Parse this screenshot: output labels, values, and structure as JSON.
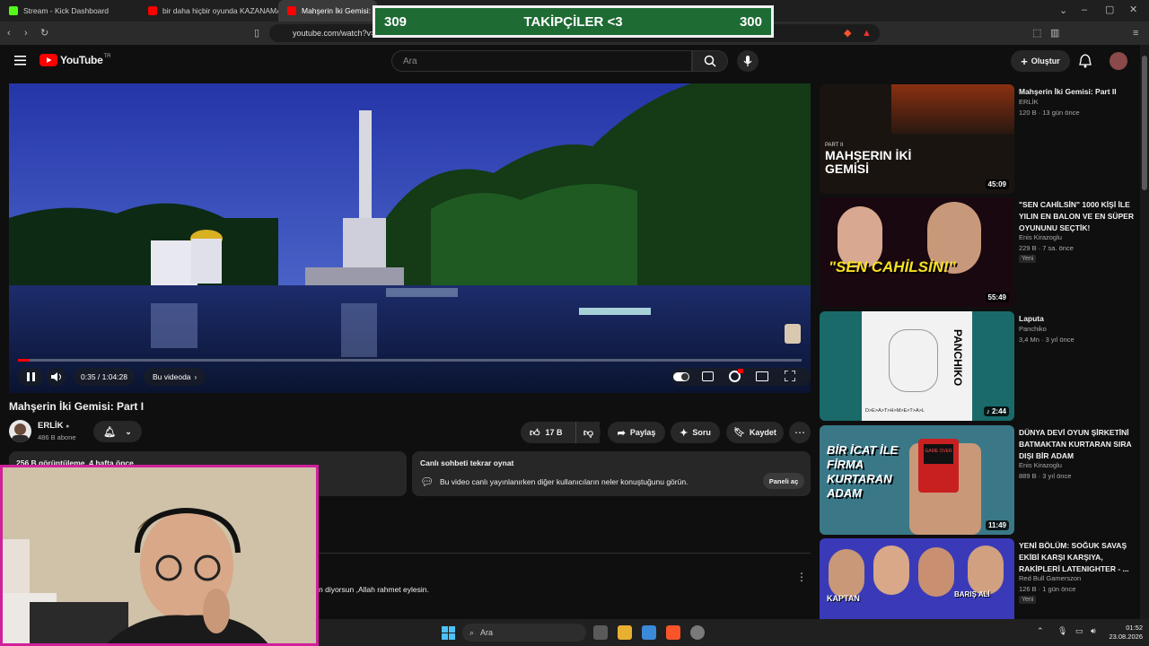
{
  "browser": {
    "tabs": [
      {
        "title": "Stream - Kick Dashboard",
        "fav_color": "#53fc18"
      },
      {
        "title": "bir daha hiçbir oyunda KAZANAMAYACAĞIM",
        "fav_color": "#ff0000"
      },
      {
        "title": "Mahşerin İki Gemisi: Part I",
        "fav_color": "#ff0000"
      }
    ],
    "url": "youtube.com/watch?v="
  },
  "overlay": {
    "left_count": "309",
    "label": "TAKİPÇİLER <3",
    "right_count": "300"
  },
  "header": {
    "logo_text": "YouTube",
    "region": "TR",
    "search_placeholder": "Ara",
    "create_label": "Oluştur"
  },
  "player": {
    "time": "0:35 / 1:04:28",
    "chapter": "Bu videoda",
    "progress": 0.009
  },
  "video": {
    "title": "Mahşerin İki Gemisi: Part I",
    "channel": "ERLİK",
    "subscribers": "486 B abone",
    "likes": "17 B",
    "share_label": "Paylaş",
    "ask_label": "Soru",
    "save_label": "Kaydet",
    "views": "256 B görüntüleme",
    "age": "4 hafta önce"
  },
  "chat": {
    "title": "Canlı sohbeti tekrar oynat",
    "description": "Bu video canlı yayınlanırken diğer kullanıcıların neler konuştuğunu görün.",
    "open_label": "Paneli aç"
  },
  "comment": {
    "text": "n diyorsun ,Allah rahmet eylesin."
  },
  "recommendations": [
    {
      "title": "Mahşerin İki Gemisi: Part II",
      "channel": "ERLİK",
      "meta": "120 B · 13 gün önce",
      "duration": "45:09",
      "thumb_text": "MAHŞERIN İKİ GEMİSİ",
      "thumb_sub": "PART II",
      "is_new": false
    },
    {
      "title": "\"SEN CAHİLSİN\" 1000 KİŞİ İLE YILIN EN BALON VE EN SÜPER OYUNUNU SEÇTİK!",
      "channel": "Enis Kirazoglu",
      "meta": "229 B · 7 sa. önce",
      "duration": "55:49",
      "thumb_text": "\"SEN CAHİLSİN!\"",
      "badge": "Yeni",
      "is_new": true
    },
    {
      "title": "Laputa",
      "channel": "Panchiko",
      "meta": "3,4 Mn · 3 yıl önce",
      "duration": "2:44",
      "thumb_text": "PANCHIKO",
      "thumb_sub": "D>E>A>T>H>M>E>T>A>L",
      "is_new": false
    },
    {
      "title": "DÜNYA DEVİ OYUN ŞİRKETİNİ BATMAKTAN KURTARAN SIRA DIŞI BİR ADAM",
      "channel": "Enis Kirazoglu",
      "meta": "889 B · 3 yıl önce",
      "duration": "11:49",
      "thumb_text": "BİR İCAT İLE FİRMA KURTARAN ADAM",
      "thumb_sub": "GAME OVER",
      "is_new": false
    },
    {
      "title": "YENİ BÖLÜM: SOĞUK SAVAŞ EKİBİ KARŞI KARŞIYA, RAKİPLERİ LATENIGHTER - ...",
      "channel": "Red Bull Gamerszon",
      "meta": "126 B · 1 gün önce",
      "duration": "",
      "thumb_text": "KAPTAN",
      "thumb_sub": "BARIŞ ALİ",
      "badge": "Yeni",
      "is_new": true
    }
  ],
  "taskbar": {
    "search_placeholder": "Ara",
    "time": "01:52",
    "date": "23.08.2026"
  }
}
